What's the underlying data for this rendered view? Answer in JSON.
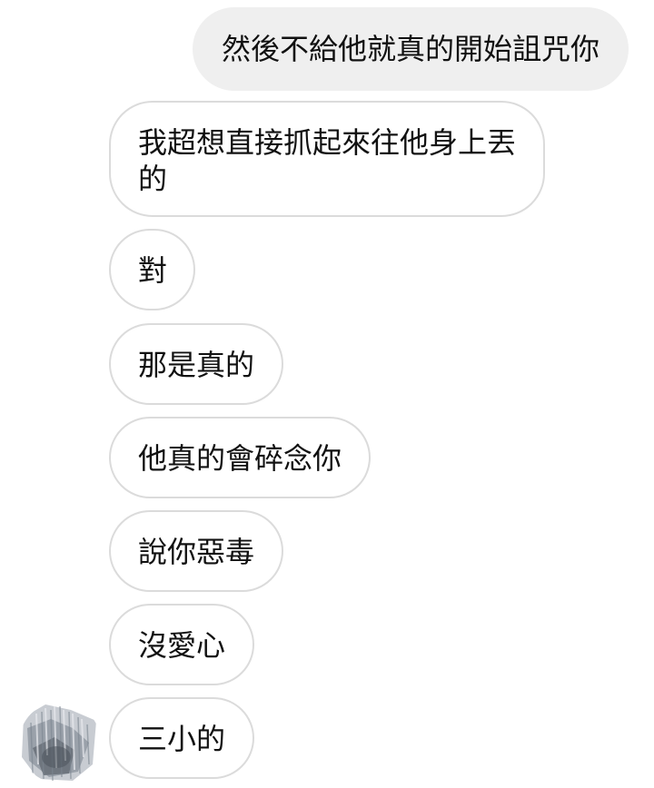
{
  "chat": {
    "outgoing": [
      {
        "text": "然後不給他就真的開始詛咒你"
      }
    ],
    "incoming": [
      {
        "text": "我超想直接抓起來往他身上丟的"
      },
      {
        "text": "對"
      },
      {
        "text": "那是真的"
      },
      {
        "text": "他真的會碎念你"
      },
      {
        "text": "說你惡毒"
      },
      {
        "text": "沒愛心"
      },
      {
        "text": "三小的"
      }
    ]
  },
  "colors": {
    "outgoing_bg": "#efefef",
    "incoming_border": "#dbdbdb",
    "text": "#111111"
  }
}
